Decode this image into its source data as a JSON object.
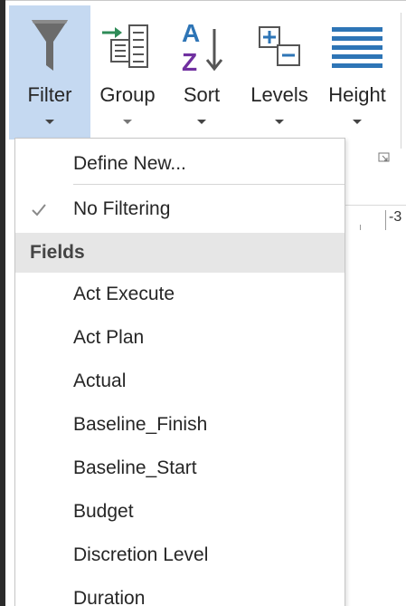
{
  "ribbon": {
    "buttons": [
      {
        "id": "filter",
        "label": "Filter",
        "icon": "funnel-icon",
        "active": true
      },
      {
        "id": "group",
        "label": "Group",
        "icon": "group-icon"
      },
      {
        "id": "sort",
        "label": "Sort",
        "icon": "sort-az-icon"
      },
      {
        "id": "levels",
        "label": "Levels",
        "icon": "levels-icon"
      },
      {
        "id": "height",
        "label": "Height",
        "icon": "height-icon"
      }
    ],
    "ruler_number": "-3"
  },
  "menu": {
    "define_new": "Define New...",
    "no_filtering": "No Filtering",
    "no_filtering_checked": true,
    "fields_header": "Fields",
    "fields": [
      "Act Execute",
      "Act Plan",
      "Actual",
      "Baseline_Finish",
      "Baseline_Start",
      "Budget",
      "Discretion Level",
      "Duration"
    ]
  },
  "colors": {
    "active_button": "#c5d9f1",
    "icon_blue": "#2e75b6",
    "icon_purple": "#7030a0",
    "icon_green": "#2e8b57",
    "section_header_bg": "#e6e6e6"
  }
}
